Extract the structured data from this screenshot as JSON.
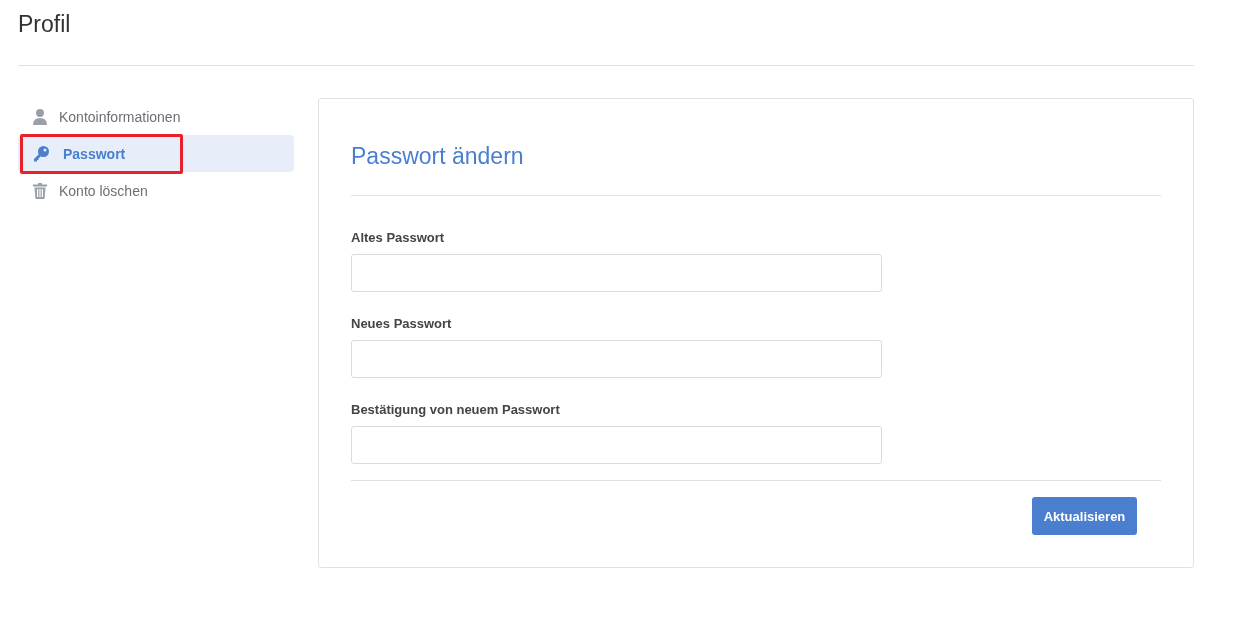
{
  "page_title": "Profil",
  "sidebar": {
    "items": [
      {
        "label": "Kontoinformationen",
        "kind": "user",
        "selected": false,
        "annotated": false
      },
      {
        "label": "Passwort",
        "kind": "key",
        "selected": true,
        "annotated": true
      },
      {
        "label": "Konto löschen",
        "kind": "trash",
        "selected": false,
        "annotated": false
      }
    ]
  },
  "card": {
    "title": "Passwort ändern",
    "fields": [
      {
        "label": "Altes Passwort"
      },
      {
        "label": "Neues Passwort"
      },
      {
        "label": "Bestätigung von neuem Passwort"
      }
    ],
    "submit_button": "Aktualisieren"
  }
}
